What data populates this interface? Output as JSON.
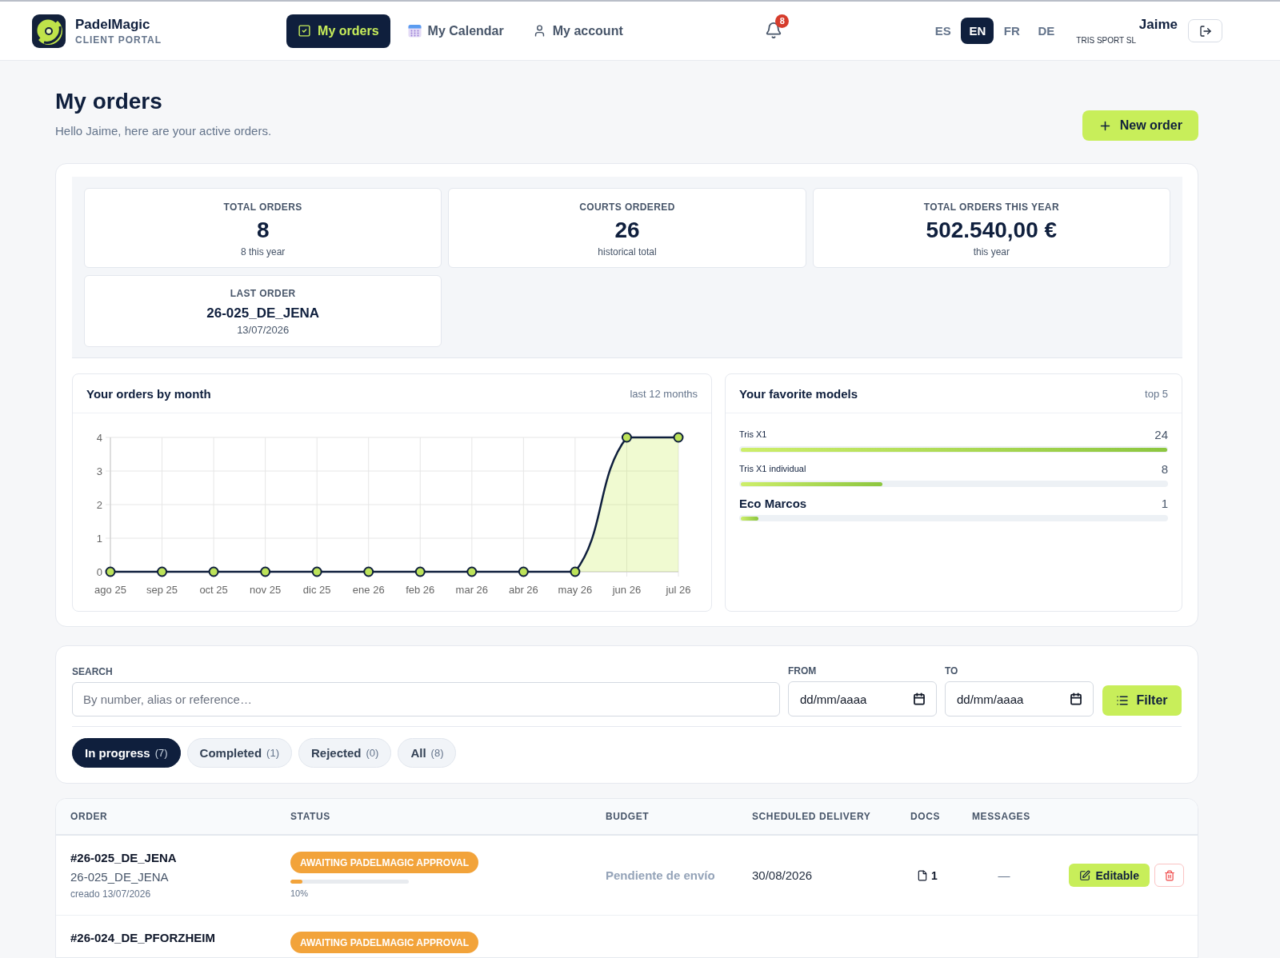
{
  "header": {
    "brand": {
      "name": "PadelMagic",
      "tagline": "CLIENT PORTAL"
    },
    "nav": [
      {
        "label": "My orders",
        "selected": true
      },
      {
        "label": "My Calendar",
        "selected": false
      },
      {
        "label": "My account",
        "selected": false
      }
    ],
    "notifications": {
      "badge": "8"
    },
    "languages": [
      {
        "label": "ES",
        "selected": false
      },
      {
        "label": "EN",
        "selected": true
      },
      {
        "label": "FR",
        "selected": false
      },
      {
        "label": "DE",
        "selected": false
      }
    ],
    "user": {
      "name": "Jaime",
      "company": "TRIS SPORT SL"
    }
  },
  "page_header": {
    "title": "My orders",
    "subtitle": "Hello Jaime, here are your active orders.",
    "new_order_button": "New order"
  },
  "stats": [
    {
      "kind": "metric",
      "label": "TOTAL ORDERS",
      "value": "8",
      "note": "8 this year"
    },
    {
      "kind": "metric",
      "label": "COURTS ORDERED",
      "value": "26",
      "note": "historical total"
    },
    {
      "kind": "metric",
      "label": "TOTAL ORDERS THIS YEAR",
      "value": "502.540,00 €",
      "note": "this year"
    },
    {
      "kind": "reference",
      "label": "LAST ORDER",
      "value": "26-025_DE_JENA",
      "note": "13/07/2026"
    }
  ],
  "orders_chart": {
    "note": "last 12 months",
    "chart_data": {
      "type": "area",
      "title": "Your orders by month",
      "categories": [
        "ago 25",
        "sep 25",
        "oct 25",
        "nov 25",
        "dic 25",
        "ene 26",
        "feb 26",
        "mar 26",
        "abr 26",
        "may 26",
        "jun 26",
        "jul 26"
      ],
      "values": [
        0,
        0,
        0,
        0,
        0,
        0,
        0,
        0,
        0,
        0,
        4,
        4
      ],
      "ylim": [
        0,
        4
      ],
      "yticks": [
        0,
        1,
        2,
        3,
        4
      ],
      "grid": true,
      "marker": true
    }
  },
  "favorite_models": {
    "title": "Your favorite models",
    "note": "top 5",
    "items": [
      {
        "name": "Tris X1",
        "count": "24",
        "level": 1,
        "emphasis": false
      },
      {
        "name": "Tris X1 individual",
        "count": "8",
        "level": 0.333,
        "emphasis": false
      },
      {
        "name": "Eco Marcos",
        "count": "1",
        "level": 0.042,
        "emphasis": true
      }
    ]
  },
  "filters": {
    "search": {
      "label": "SEARCH",
      "placeholder": "By number, alias or reference…"
    },
    "from": {
      "label": "FROM",
      "placeholder": "dd/mm/aaaa"
    },
    "to": {
      "label": "TO",
      "placeholder": "dd/mm/aaaa"
    },
    "filter_button": "Filter"
  },
  "status_tabs": [
    {
      "label": "In progress",
      "count": "(7)",
      "selected": true
    },
    {
      "label": "Completed",
      "count": "(1)",
      "selected": false
    },
    {
      "label": "Rejected",
      "count": "(0)",
      "selected": false
    },
    {
      "label": "All",
      "count": "(8)",
      "selected": false
    }
  ],
  "table": {
    "columns": [
      "ORDER",
      "STATUS",
      "BUDGET",
      "SCHEDULED DELIVERY",
      "DOCS",
      "MESSAGES"
    ],
    "rows": [
      {
        "order": "#26-025_DE_JENA",
        "alias": "26-025_DE_JENA",
        "created": "creado 13/07/2026",
        "status": "AWAITING PADELMAGIC APPROVAL",
        "progress": {
          "level": 0.1,
          "label": "10%"
        },
        "budget": "Pendiente de envío",
        "delivery": "30/08/2026",
        "docs": "1",
        "messages": "—",
        "edit_button": "Editable"
      },
      {
        "order": "#26-024_DE_PFORZHEIM",
        "status": "AWAITING PADELMAGIC APPROVAL"
      }
    ]
  }
}
